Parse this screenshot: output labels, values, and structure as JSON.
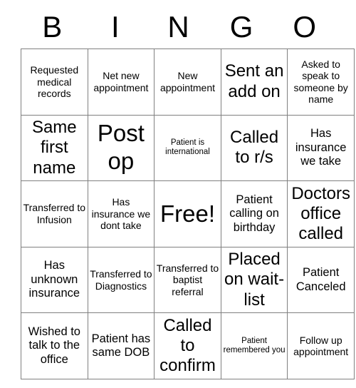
{
  "card": {
    "title": "BINGO",
    "header_letters": [
      "B",
      "I",
      "N",
      "G",
      "O"
    ],
    "free_space_label": "Free!",
    "colors": {
      "text": "#000000",
      "grid_line": "#808080",
      "cell_background": "#ffffff",
      "page_background": "#ffffff"
    },
    "grid": {
      "columns": 5,
      "rows": 5
    },
    "cells": [
      [
        {
          "text": "Requested medical records",
          "size": "sm"
        },
        {
          "text": "Net new appointment",
          "size": "sm"
        },
        {
          "text": "New appointment",
          "size": "sm"
        },
        {
          "text": "Sent an add on",
          "size": "xl"
        },
        {
          "text": "Asked to speak to someone by name",
          "size": "sm"
        }
      ],
      [
        {
          "text": "Same first name",
          "size": "xl"
        },
        {
          "text": "Post op",
          "size": "xxl"
        },
        {
          "text": "Patient is international",
          "size": "xs"
        },
        {
          "text": "Called to r/s",
          "size": "xl"
        },
        {
          "text": "Has insurance we take",
          "size": "md"
        }
      ],
      [
        {
          "text": "Transferred to Infusion",
          "size": "sm"
        },
        {
          "text": "Has insurance we dont take",
          "size": "sm"
        },
        {
          "text": "Free!",
          "size": "xxl"
        },
        {
          "text": "Patient calling on birthday",
          "size": "md"
        },
        {
          "text": "Doctors office called",
          "size": "xl"
        }
      ],
      [
        {
          "text": "Has unknown insurance",
          "size": "md"
        },
        {
          "text": "Transferred to Diagnostics",
          "size": "sm"
        },
        {
          "text": "Transferred to baptist referral",
          "size": "sm"
        },
        {
          "text": "Placed on wait-list",
          "size": "xl"
        },
        {
          "text": "Patient Canceled",
          "size": "md"
        }
      ],
      [
        {
          "text": "Wished to talk to the office",
          "size": "md"
        },
        {
          "text": "Patient has same DOB",
          "size": "md"
        },
        {
          "text": "Called to confirm",
          "size": "xl"
        },
        {
          "text": "Patient remembered you",
          "size": "xs"
        },
        {
          "text": "Follow up appointment",
          "size": "sm"
        }
      ]
    ]
  }
}
